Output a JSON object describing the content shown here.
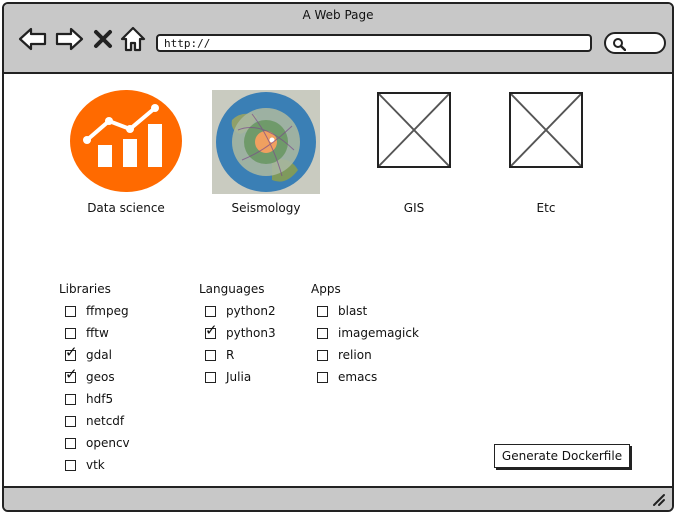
{
  "window": {
    "title": "A Web Page"
  },
  "nav": {
    "back_icon": "back-arrow-icon",
    "forward_icon": "forward-arrow-icon",
    "stop_icon": "close-icon",
    "home_icon": "home-icon"
  },
  "address_bar": {
    "value": "http://"
  },
  "search": {
    "icon": "search-icon"
  },
  "tiles": [
    {
      "label": "Data science",
      "image": "data-science-chart-icon",
      "accent": "#ff6a00"
    },
    {
      "label": "Seismology",
      "image": "earth-globe-image"
    },
    {
      "label": "GIS",
      "image": "image-placeholder"
    },
    {
      "label": "Etc",
      "image": "image-placeholder"
    }
  ],
  "libraries": {
    "title": "Libraries",
    "items": [
      {
        "label": "ffmpeg",
        "checked": false
      },
      {
        "label": "fftw",
        "checked": false
      },
      {
        "label": "gdal",
        "checked": true
      },
      {
        "label": "geos",
        "checked": true
      },
      {
        "label": "hdf5",
        "checked": false
      },
      {
        "label": "netcdf",
        "checked": false
      },
      {
        "label": "opencv",
        "checked": false
      },
      {
        "label": "vtk",
        "checked": false
      }
    ]
  },
  "languages": {
    "title": "Languages",
    "items": [
      {
        "label": "python2",
        "checked": false
      },
      {
        "label": "python3",
        "checked": true
      },
      {
        "label": "R",
        "checked": false
      },
      {
        "label": "Julia",
        "checked": false
      }
    ]
  },
  "apps": {
    "title": "Apps",
    "items": [
      {
        "label": "blast",
        "checked": false
      },
      {
        "label": "imagemagick",
        "checked": false
      },
      {
        "label": "relion",
        "checked": false
      },
      {
        "label": "emacs",
        "checked": false
      }
    ]
  },
  "generate_button": {
    "label": "Generate Dockerfile"
  }
}
